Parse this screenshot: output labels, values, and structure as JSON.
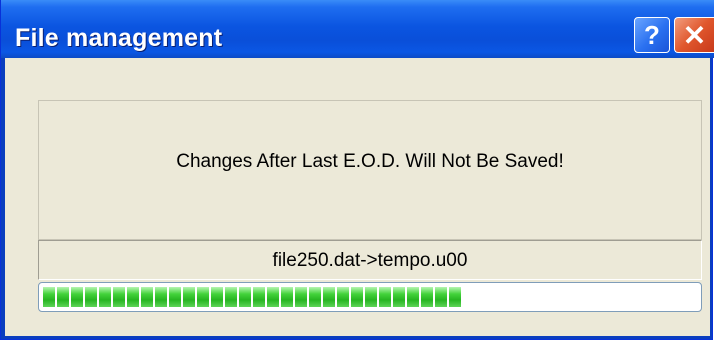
{
  "window": {
    "title": "File management",
    "help_glyph": "?",
    "close_glyph": "✕"
  },
  "dialog": {
    "message": "Changes After Last E.O.D. Will Not Be Saved!",
    "current_file": "file250.dat->tempo.u00"
  },
  "progress": {
    "percent": 65,
    "color": "#27b521"
  },
  "icons": {
    "help": "question-mark-icon",
    "close": "close-x-icon"
  }
}
